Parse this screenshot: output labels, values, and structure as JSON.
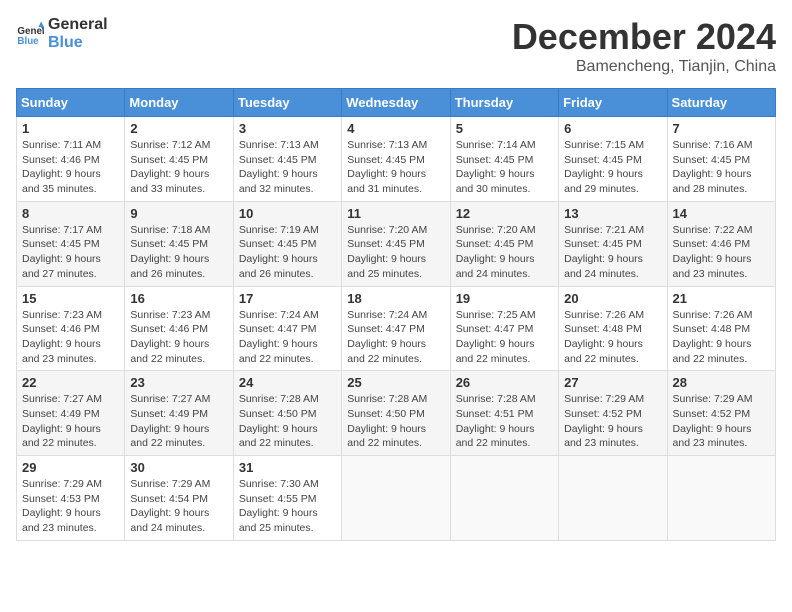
{
  "logo": {
    "line1": "General",
    "line2": "Blue"
  },
  "title": "December 2024",
  "subtitle": "Bamencheng, Tianjin, China",
  "weekdays": [
    "Sunday",
    "Monday",
    "Tuesday",
    "Wednesday",
    "Thursday",
    "Friday",
    "Saturday"
  ],
  "weeks": [
    [
      {
        "day": "1",
        "detail": "Sunrise: 7:11 AM\nSunset: 4:46 PM\nDaylight: 9 hours\nand 35 minutes."
      },
      {
        "day": "2",
        "detail": "Sunrise: 7:12 AM\nSunset: 4:45 PM\nDaylight: 9 hours\nand 33 minutes."
      },
      {
        "day": "3",
        "detail": "Sunrise: 7:13 AM\nSunset: 4:45 PM\nDaylight: 9 hours\nand 32 minutes."
      },
      {
        "day": "4",
        "detail": "Sunrise: 7:13 AM\nSunset: 4:45 PM\nDaylight: 9 hours\nand 31 minutes."
      },
      {
        "day": "5",
        "detail": "Sunrise: 7:14 AM\nSunset: 4:45 PM\nDaylight: 9 hours\nand 30 minutes."
      },
      {
        "day": "6",
        "detail": "Sunrise: 7:15 AM\nSunset: 4:45 PM\nDaylight: 9 hours\nand 29 minutes."
      },
      {
        "day": "7",
        "detail": "Sunrise: 7:16 AM\nSunset: 4:45 PM\nDaylight: 9 hours\nand 28 minutes."
      }
    ],
    [
      {
        "day": "8",
        "detail": "Sunrise: 7:17 AM\nSunset: 4:45 PM\nDaylight: 9 hours\nand 27 minutes."
      },
      {
        "day": "9",
        "detail": "Sunrise: 7:18 AM\nSunset: 4:45 PM\nDaylight: 9 hours\nand 26 minutes."
      },
      {
        "day": "10",
        "detail": "Sunrise: 7:19 AM\nSunset: 4:45 PM\nDaylight: 9 hours\nand 26 minutes."
      },
      {
        "day": "11",
        "detail": "Sunrise: 7:20 AM\nSunset: 4:45 PM\nDaylight: 9 hours\nand 25 minutes."
      },
      {
        "day": "12",
        "detail": "Sunrise: 7:20 AM\nSunset: 4:45 PM\nDaylight: 9 hours\nand 24 minutes."
      },
      {
        "day": "13",
        "detail": "Sunrise: 7:21 AM\nSunset: 4:45 PM\nDaylight: 9 hours\nand 24 minutes."
      },
      {
        "day": "14",
        "detail": "Sunrise: 7:22 AM\nSunset: 4:46 PM\nDaylight: 9 hours\nand 23 minutes."
      }
    ],
    [
      {
        "day": "15",
        "detail": "Sunrise: 7:23 AM\nSunset: 4:46 PM\nDaylight: 9 hours\nand 23 minutes."
      },
      {
        "day": "16",
        "detail": "Sunrise: 7:23 AM\nSunset: 4:46 PM\nDaylight: 9 hours\nand 22 minutes."
      },
      {
        "day": "17",
        "detail": "Sunrise: 7:24 AM\nSunset: 4:47 PM\nDaylight: 9 hours\nand 22 minutes."
      },
      {
        "day": "18",
        "detail": "Sunrise: 7:24 AM\nSunset: 4:47 PM\nDaylight: 9 hours\nand 22 minutes."
      },
      {
        "day": "19",
        "detail": "Sunrise: 7:25 AM\nSunset: 4:47 PM\nDaylight: 9 hours\nand 22 minutes."
      },
      {
        "day": "20",
        "detail": "Sunrise: 7:26 AM\nSunset: 4:48 PM\nDaylight: 9 hours\nand 22 minutes."
      },
      {
        "day": "21",
        "detail": "Sunrise: 7:26 AM\nSunset: 4:48 PM\nDaylight: 9 hours\nand 22 minutes."
      }
    ],
    [
      {
        "day": "22",
        "detail": "Sunrise: 7:27 AM\nSunset: 4:49 PM\nDaylight: 9 hours\nand 22 minutes."
      },
      {
        "day": "23",
        "detail": "Sunrise: 7:27 AM\nSunset: 4:49 PM\nDaylight: 9 hours\nand 22 minutes."
      },
      {
        "day": "24",
        "detail": "Sunrise: 7:28 AM\nSunset: 4:50 PM\nDaylight: 9 hours\nand 22 minutes."
      },
      {
        "day": "25",
        "detail": "Sunrise: 7:28 AM\nSunset: 4:50 PM\nDaylight: 9 hours\nand 22 minutes."
      },
      {
        "day": "26",
        "detail": "Sunrise: 7:28 AM\nSunset: 4:51 PM\nDaylight: 9 hours\nand 22 minutes."
      },
      {
        "day": "27",
        "detail": "Sunrise: 7:29 AM\nSunset: 4:52 PM\nDaylight: 9 hours\nand 23 minutes."
      },
      {
        "day": "28",
        "detail": "Sunrise: 7:29 AM\nSunset: 4:52 PM\nDaylight: 9 hours\nand 23 minutes."
      }
    ],
    [
      {
        "day": "29",
        "detail": "Sunrise: 7:29 AM\nSunset: 4:53 PM\nDaylight: 9 hours\nand 23 minutes."
      },
      {
        "day": "30",
        "detail": "Sunrise: 7:29 AM\nSunset: 4:54 PM\nDaylight: 9 hours\nand 24 minutes."
      },
      {
        "day": "31",
        "detail": "Sunrise: 7:30 AM\nSunset: 4:55 PM\nDaylight: 9 hours\nand 25 minutes."
      },
      null,
      null,
      null,
      null
    ]
  ]
}
